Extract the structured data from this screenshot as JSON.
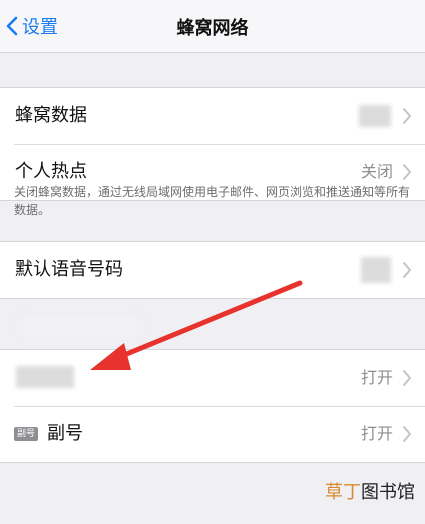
{
  "nav": {
    "back_label": "设置",
    "title": "蜂窝网络"
  },
  "group1": {
    "rows": [
      {
        "label": "蜂窝数据",
        "value": ""
      },
      {
        "label": "个人热点",
        "value": "关闭"
      }
    ],
    "footnote": "关闭蜂窝数据，通过无线局域网使用电子邮件、网页浏览和推送通知等所有数据。"
  },
  "group2": {
    "rows": [
      {
        "label": "默认语音号码",
        "value": ""
      }
    ]
  },
  "group3": {
    "rows": [
      {
        "label": "",
        "value": "打开"
      },
      {
        "badge": "副号",
        "label": "副号",
        "value": "打开"
      }
    ]
  },
  "watermark": {
    "accent": "草丁",
    "text": "图书馆"
  },
  "colors": {
    "accent": "#1a7cf5",
    "annotation_arrow": "#e8322e"
  }
}
